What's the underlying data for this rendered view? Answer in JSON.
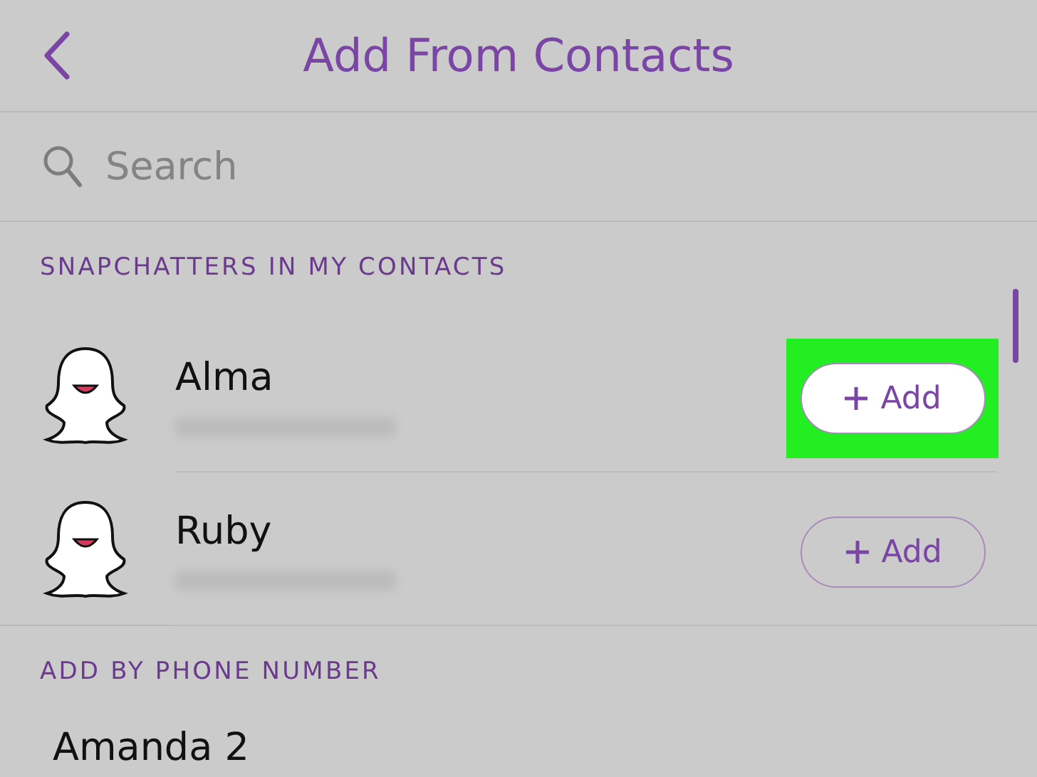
{
  "header": {
    "title": "Add From Contacts"
  },
  "search": {
    "placeholder": "Search"
  },
  "sections": [
    {
      "title": "SNAPCHATTERS IN MY CONTACTS",
      "contacts": [
        {
          "kind": "snapchatter",
          "name": "Alma",
          "button": "Add",
          "highlighted": true
        },
        {
          "kind": "snapchatter",
          "name": "Ruby",
          "button": "Add",
          "highlighted": false
        }
      ]
    },
    {
      "title": "ADD BY PHONE NUMBER",
      "contacts": [
        {
          "kind": "phone",
          "name": "Amanda 2"
        }
      ]
    }
  ]
}
